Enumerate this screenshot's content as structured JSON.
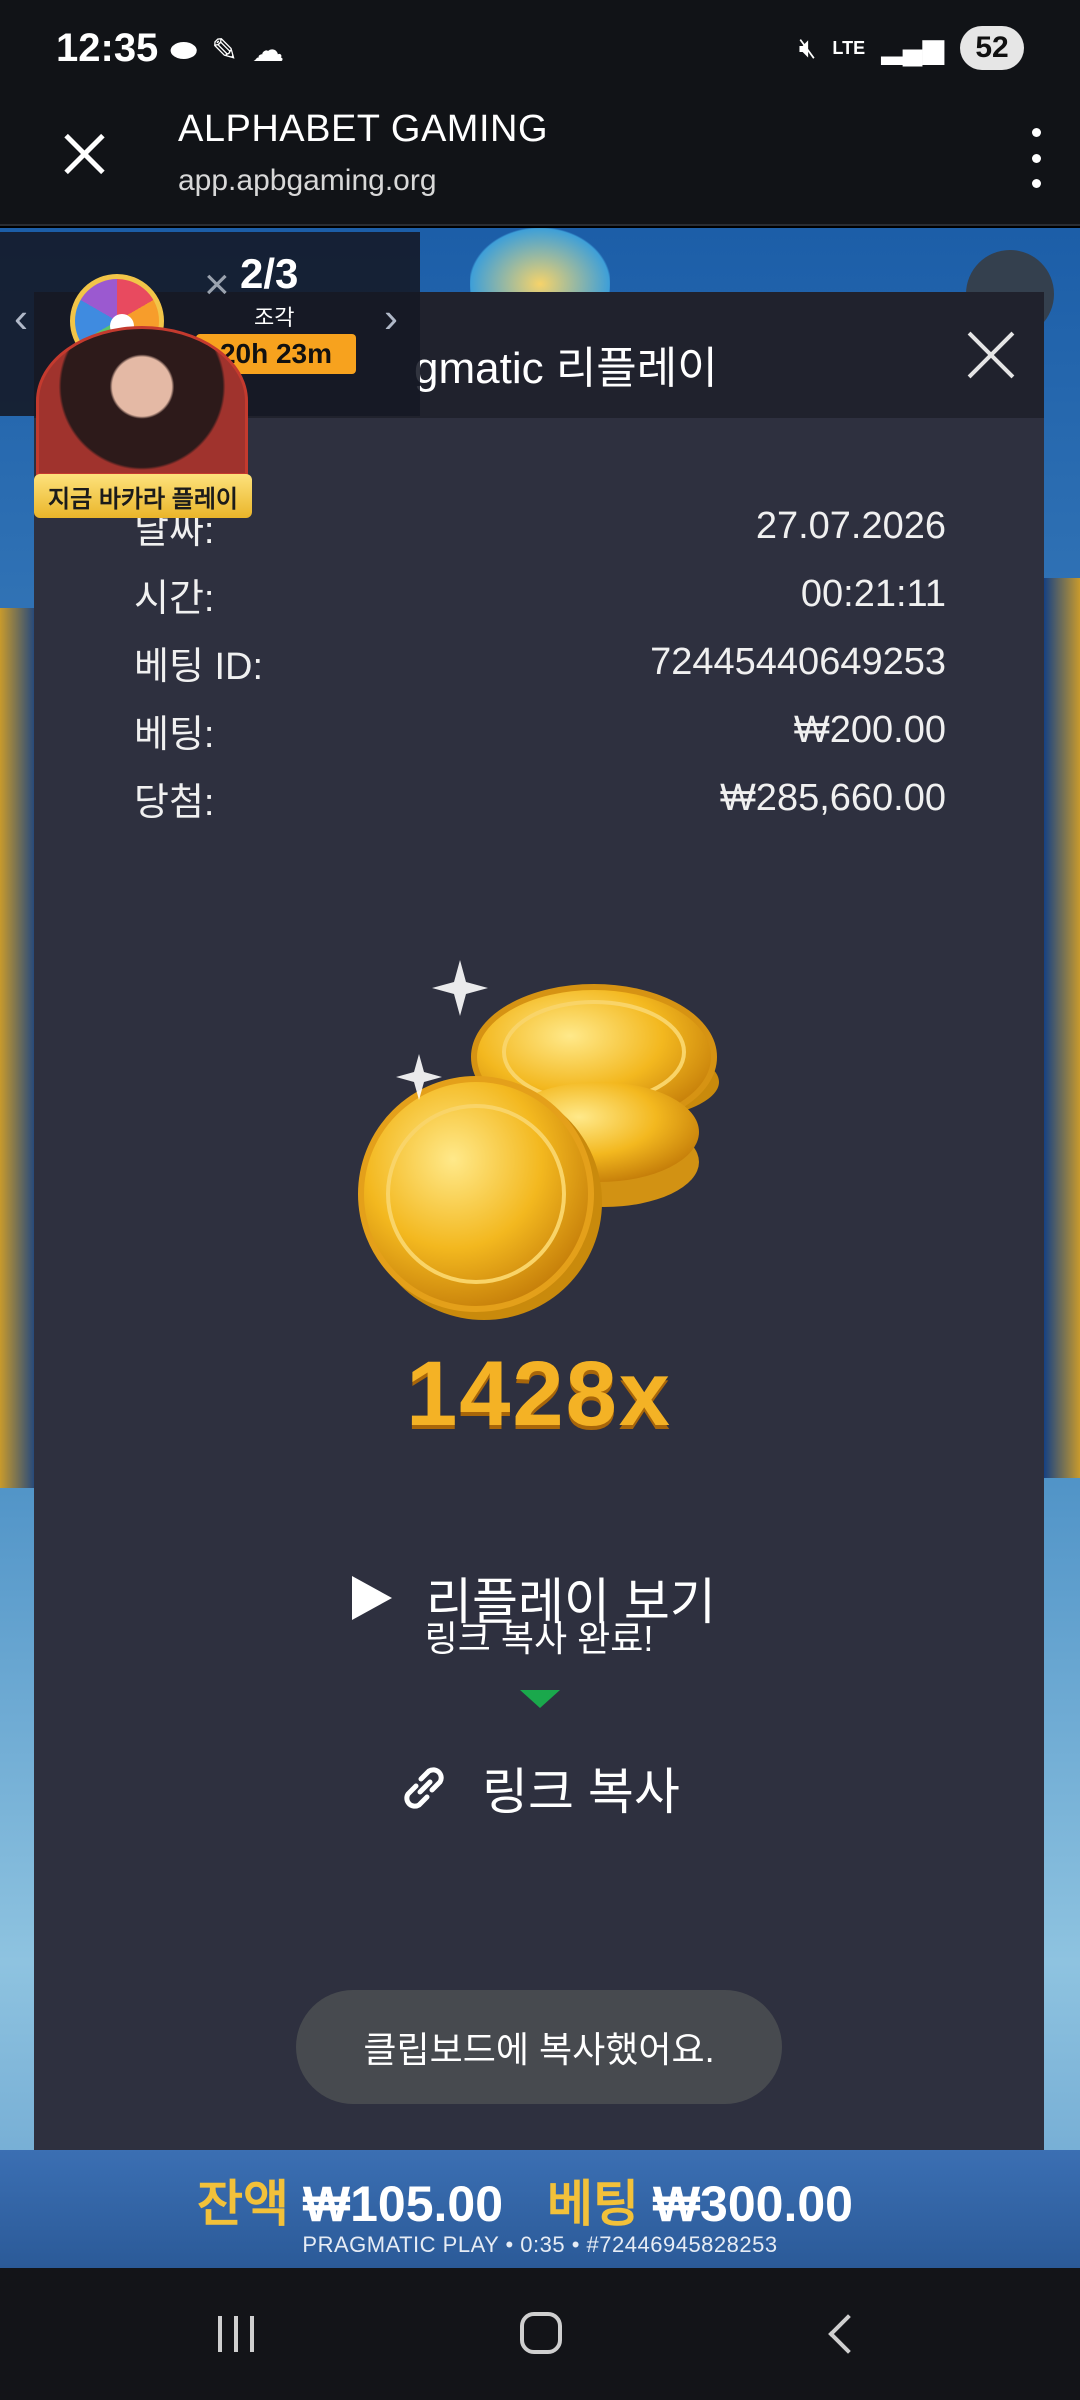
{
  "status_bar": {
    "time": "12:35",
    "left_icons": [
      "pill-icon",
      "ruler-icon",
      "cloud-icon"
    ],
    "network": "LTE",
    "battery": "52"
  },
  "browser": {
    "title": "ALPHABET GAMING",
    "url": "app.apbgaming.org"
  },
  "promo": {
    "count": "2/3",
    "piece_label": "조각",
    "timer": "20h 23m",
    "badge": "지금 바카라 플레이"
  },
  "modal": {
    "title": "gmatic 리플레이",
    "details": [
      {
        "label": "날짜:",
        "value": "27.07.2026"
      },
      {
        "label": "시간:",
        "value": "00:21:11"
      },
      {
        "label": "베팅 ID:",
        "value": "72445440649253"
      },
      {
        "label": "베팅:",
        "value": "₩200.00"
      },
      {
        "label": "당첨:",
        "value": "₩285,660.00"
      }
    ],
    "multiplier": "1428x",
    "replay_label": "리플레이 보기",
    "copied_message": "링크 복사 완료!",
    "copy_link_label": "링크 복사",
    "toast": "클립보드에 복사했어요."
  },
  "game_footer": {
    "balance_label": "잔액",
    "balance_value": "₩105.00",
    "bet_label": "베팅",
    "bet_value": "₩300.00",
    "info": "PRAGMATIC PLAY • 0:35 • #72446945828253"
  },
  "colors": {
    "accent_gold": "#f4b225",
    "modal_bg": "#2e303f",
    "timer_orange": "#f7a21e",
    "tooltip_green": "#1aa84c"
  }
}
